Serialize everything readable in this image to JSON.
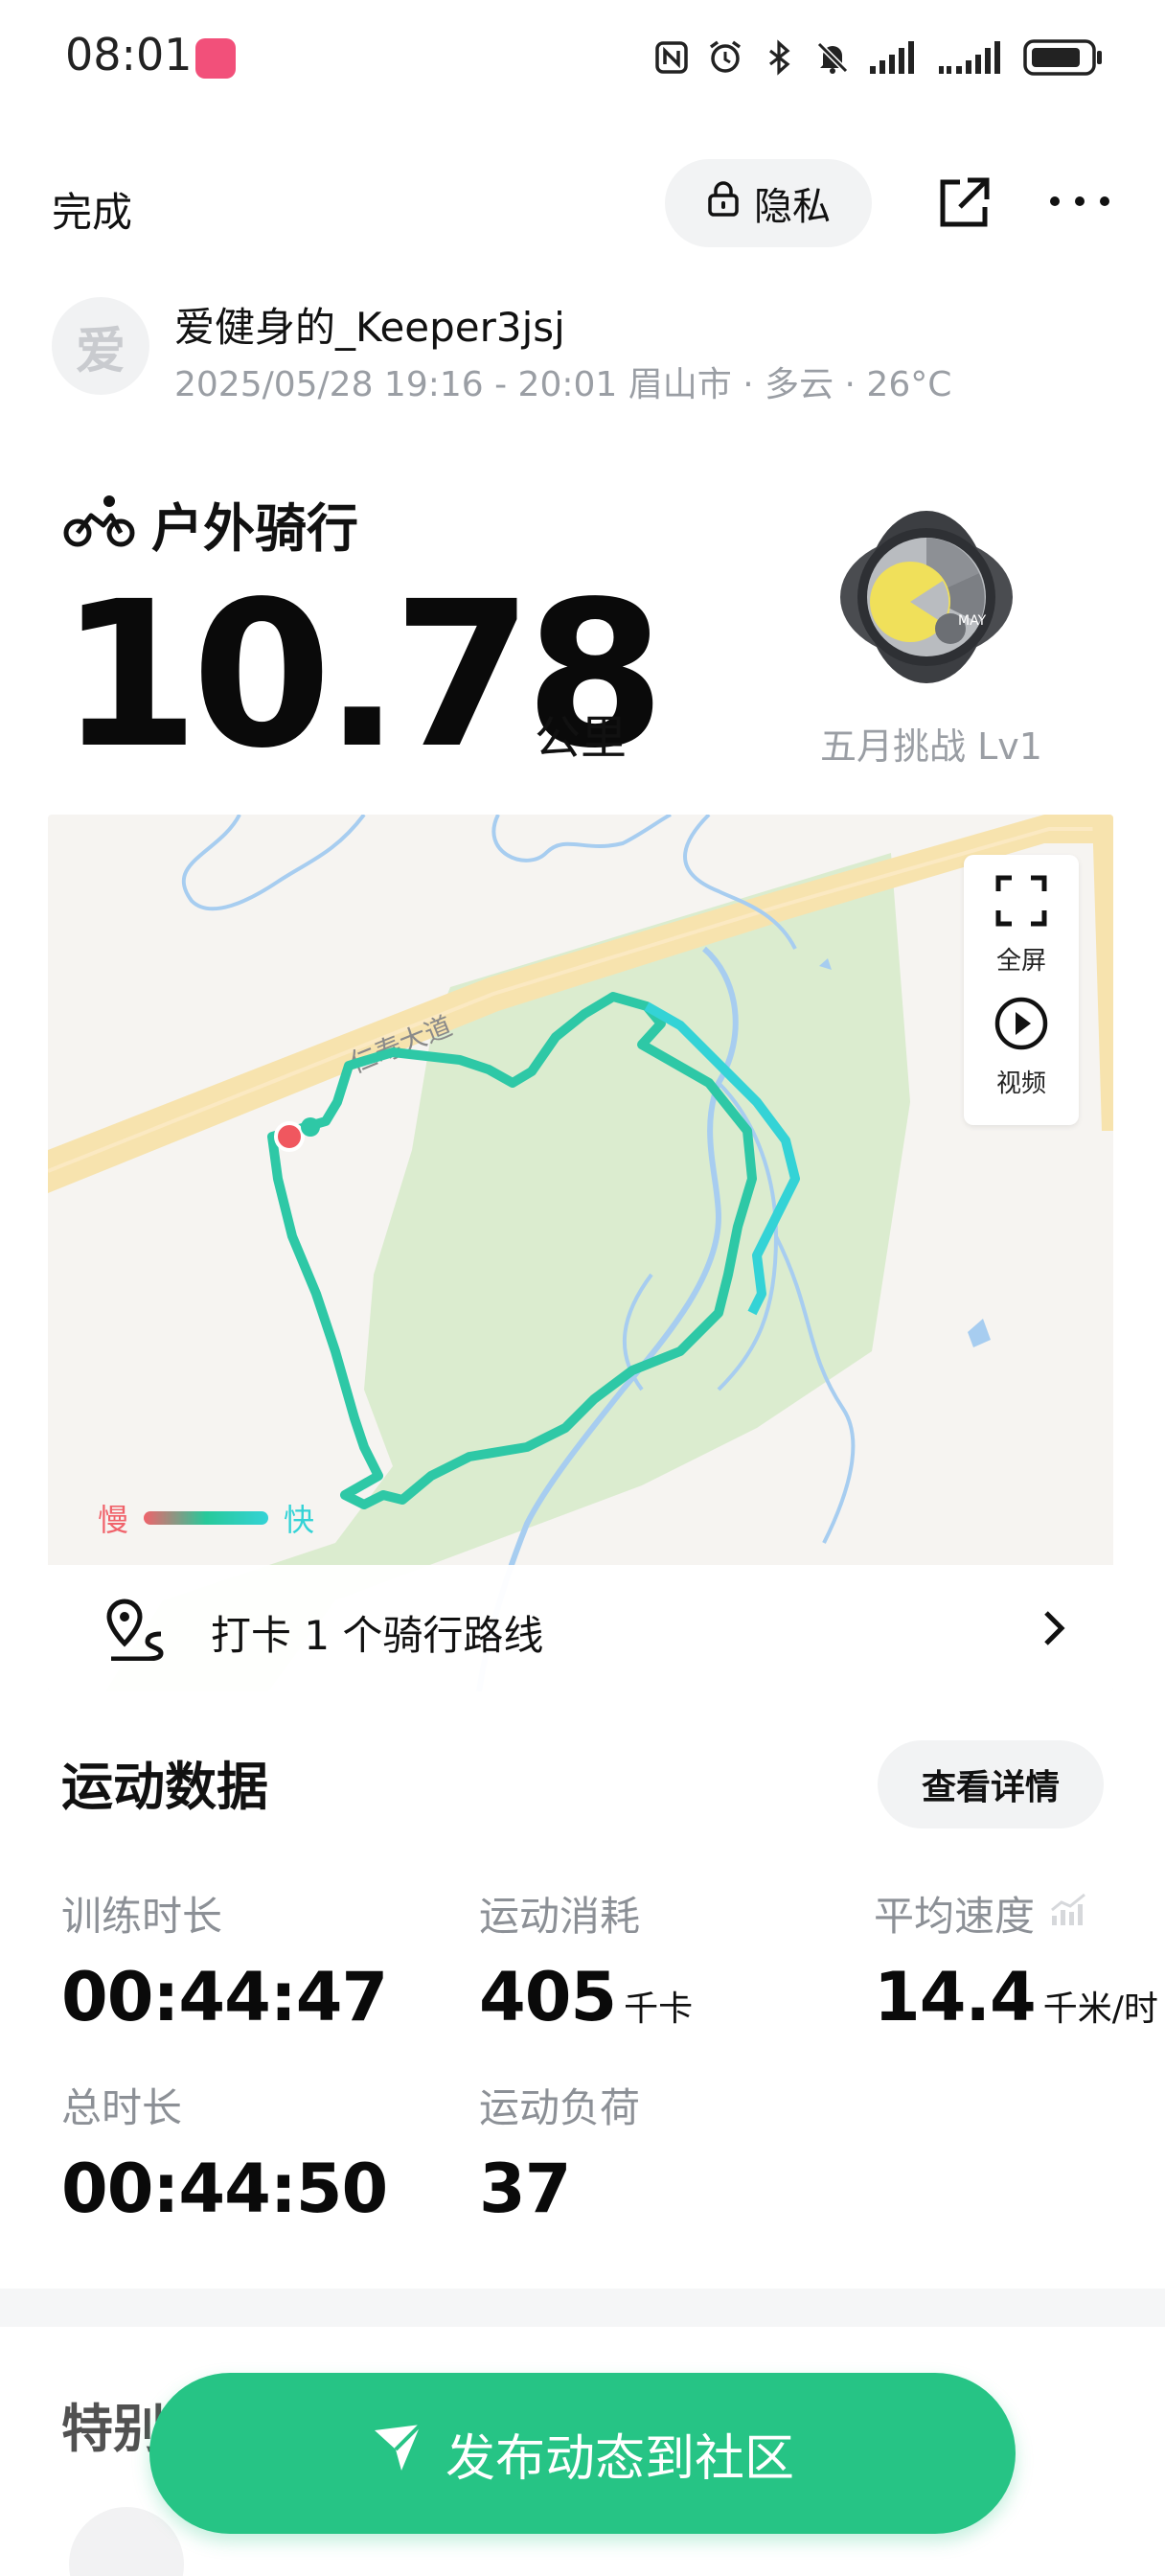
{
  "status_bar": {
    "time": "08:01",
    "icons": [
      "nfc-icon",
      "alarm-icon",
      "bluetooth-icon",
      "mute-icon",
      "signal-icon",
      "signal-2-icon",
      "battery-icon"
    ]
  },
  "header": {
    "done_label": "完成",
    "privacy_label": "隐私"
  },
  "user": {
    "avatar_text": "爱",
    "name": "爱健身的_Keeper3jsj",
    "meta": "2025/05/28 19:16 - 20:01 眉山市 · 多云 · 26°C"
  },
  "activity": {
    "title": "户外骑行",
    "distance": "10.78",
    "distance_unit": "公里",
    "badge_label": "五月挑战 Lv1"
  },
  "map": {
    "road_label": "仁寿大道",
    "fullscreen_label": "全屏",
    "video_label": "视频",
    "legend_slow": "慢",
    "legend_fast": "快",
    "route_text": "打卡 1 个骑行路线",
    "colors": {
      "route": "#2ec8a6",
      "start": "#f0575f",
      "water": "#a7cdf0",
      "park": "#dbecd2",
      "road": "#f8e6b4"
    }
  },
  "stats": {
    "section_title": "运动数据",
    "detail_label": "查看详情",
    "items": [
      {
        "label": "训练时长",
        "value": "00:44:47",
        "unit": ""
      },
      {
        "label": "运动消耗",
        "value": "405",
        "unit": "千卡"
      },
      {
        "label": "平均速度",
        "value": "14.4",
        "unit": "千米/时"
      },
      {
        "label": "总时长",
        "value": "00:44:50",
        "unit": ""
      },
      {
        "label": "运动负荷",
        "value": "37",
        "unit": ""
      }
    ]
  },
  "special": {
    "title": "特别"
  },
  "publish_label": "发布动态到社区",
  "accent_color": "#26c485"
}
